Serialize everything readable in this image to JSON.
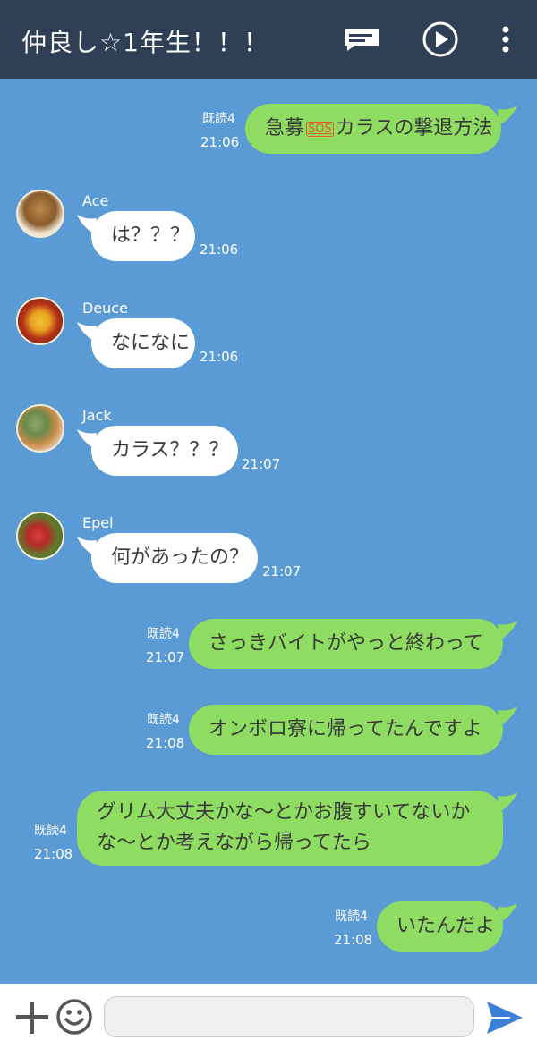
{
  "header": {
    "title": "仲良し☆1年生！！！"
  },
  "messages": [
    {
      "side": "right",
      "read": "既読4",
      "time": "21:06",
      "text_before": "急募",
      "badge": "SOS",
      "text_after": "カラスの撃退方法"
    },
    {
      "side": "left",
      "sender": "Ace",
      "time": "21:06",
      "text": "は？？？"
    },
    {
      "side": "left",
      "sender": "Deuce",
      "time": "21:06",
      "text": "なになに"
    },
    {
      "side": "left",
      "sender": "Jack",
      "time": "21:07",
      "text": "カラス？？？"
    },
    {
      "side": "left",
      "sender": "Epel",
      "time": "21:07",
      "text": "何があったの？"
    },
    {
      "side": "right",
      "read": "既読4",
      "time": "21:07",
      "text": "さっきバイトがやっと終わって"
    },
    {
      "side": "right",
      "read": "既読4",
      "time": "21:08",
      "text": "オンボロ寮に帰ってたんですよ"
    },
    {
      "side": "right",
      "read": "既読4",
      "time": "21:08",
      "line1": "グリム大丈夫かな〜とかお腹すいてないか",
      "line2": "な〜とか考えながら帰ってたら"
    },
    {
      "side": "right",
      "read": "既読4",
      "time": "21:08",
      "text": "いたんだよ"
    }
  ],
  "icons": {
    "header": [
      "note-icon",
      "play-icon",
      "more-vert-icon"
    ],
    "input": [
      "plus-icon",
      "emoji-icon",
      "send-icon"
    ]
  },
  "colors": {
    "header_bg": "#2f3f55",
    "chat_bg": "#5b9bd5",
    "sent_bubble": "#8fdc62",
    "received_bubble": "#ffffff",
    "send_icon": "#3b7fd6"
  }
}
